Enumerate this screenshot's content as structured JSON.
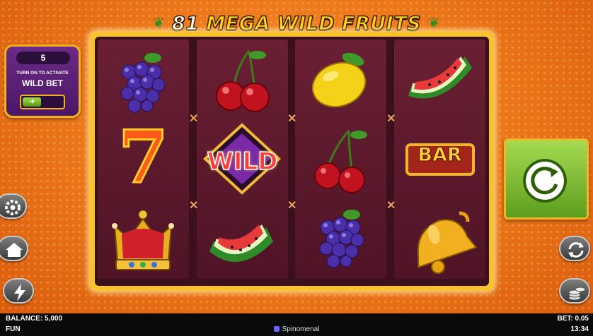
{
  "title": {
    "number": "81",
    "text": "MEGA WILD FRUITS"
  },
  "wild_bet": {
    "value": "5",
    "line1": "TURN ON TO ACTIVATE",
    "line2": "WILD BET",
    "toggle_icon": "arrow-right-icon"
  },
  "reels": [
    [
      "grapes",
      "seven",
      "crown"
    ],
    [
      "cherries",
      "wild",
      "watermelon"
    ],
    [
      "lemon",
      "cherries",
      "grapes"
    ],
    [
      "watermelon",
      "bar",
      "bell"
    ]
  ],
  "symbols": {
    "wild_label": "WILD",
    "bar_label": "BAR",
    "seven_label": "7"
  },
  "buttons": {
    "spin": "spin-icon",
    "settings": "gear-icon",
    "home": "home-icon",
    "turbo": "lightning-icon",
    "autoplay": "autoplay-icon",
    "bet": "coins-icon"
  },
  "bottom_bar": {
    "balance": "BALANCE: 5,000",
    "mode": "FUN",
    "brand": "Spinomenal",
    "bet": "BET: 0.05",
    "time": "13:34"
  },
  "colors": {
    "frame": "#f8c22c",
    "spin_button": "#7fbf33",
    "panel": "#5a1f78",
    "background": "#ee7a1c"
  }
}
